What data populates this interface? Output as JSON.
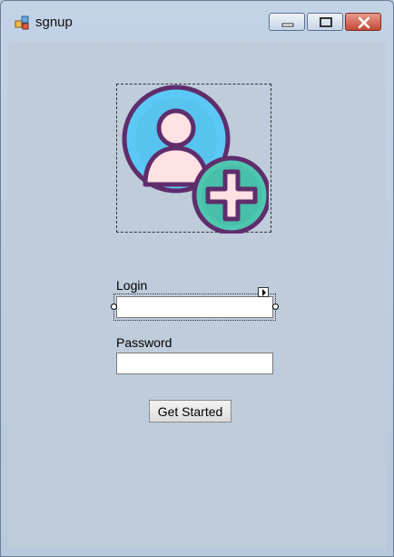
{
  "window": {
    "title": "sgnup",
    "icons": {
      "app": "winforms-app-icon",
      "minimize": "minimize-icon",
      "maximize": "maximize-icon",
      "close": "close-icon"
    }
  },
  "form": {
    "picture": {
      "icon": "add-user-icon"
    },
    "login": {
      "label": "Login",
      "value": "",
      "smart_tag_icon": "smart-tag-arrow-icon"
    },
    "password": {
      "label": "Password",
      "value": ""
    },
    "submit_label": "Get Started"
  },
  "colors": {
    "client_background": "#bfccdb",
    "close_button": "#c24a35",
    "avatar_circle": "#5bc9f5",
    "plus_circle": "#4ec7b0",
    "outline": "#5f2d6b"
  }
}
